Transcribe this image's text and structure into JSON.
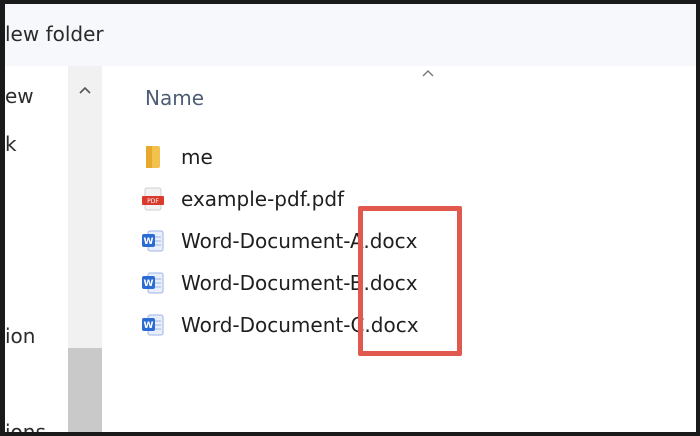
{
  "toolbar": {
    "new_folder_label": "lew folder"
  },
  "nav": {
    "items": [
      {
        "label": "ew"
      },
      {
        "label": "k"
      },
      {
        "label": "ion"
      },
      {
        "label": "ions"
      }
    ]
  },
  "list": {
    "column_header": "Name",
    "items": [
      {
        "name": "me",
        "icon": "folder-icon"
      },
      {
        "name": "example-pdf.pdf",
        "icon": "pdf-file-icon"
      },
      {
        "name": "Word-Document-A.docx",
        "icon": "word-document-icon"
      },
      {
        "name": "Word-Document-B.docx",
        "icon": "word-document-icon"
      },
      {
        "name": "Word-Document-C.docx",
        "icon": "word-document-icon"
      }
    ]
  },
  "colors": {
    "highlight": "#e0584e",
    "folder": "#f2c14e",
    "pdf": "#d93a2b",
    "word": "#2b6cd4"
  }
}
